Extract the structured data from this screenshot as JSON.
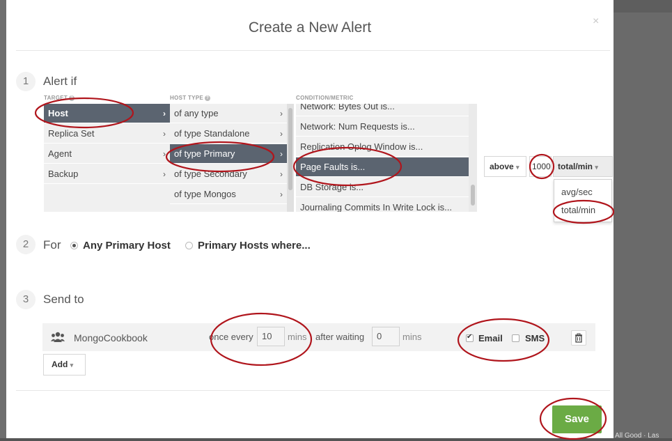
{
  "modal": {
    "title": "Create a New Alert",
    "close_glyph": "×"
  },
  "step1": {
    "number": "1",
    "label": "Alert if",
    "target_header": "TARGET",
    "host_type_header": "HOST TYPE",
    "condition_header": "CONDITION/METRIC",
    "targets": [
      "Host",
      "Replica Set",
      "Agent",
      "Backup"
    ],
    "host_types": [
      "of any type",
      "of type Standalone",
      "of type Primary",
      "of type Secondary",
      "of type Mongos"
    ],
    "conditions": [
      "Network: Bytes Out is...",
      "Network: Num Requests is...",
      "Replication Oplog Window is...",
      "Page Faults is...",
      "DB Storage is...",
      "Journaling Commits In Write Lock is..."
    ],
    "comparator": "above",
    "threshold_value": "1000",
    "unit_selected": "total/min",
    "unit_options": [
      "avg/sec",
      "total/min"
    ]
  },
  "step2": {
    "number": "2",
    "label": "For",
    "option_any": "Any Primary Host",
    "option_where": "Primary Hosts where..."
  },
  "step3": {
    "number": "3",
    "label": "Send to",
    "group_name": "MongoCookbook",
    "once_every_label": "once every",
    "once_every_value": "10",
    "mins_label_1": "mins",
    "after_waiting_label": "after waiting",
    "after_waiting_value": "0",
    "mins_label_2": "mins",
    "email_label": "Email",
    "sms_label": "SMS",
    "add_label": "Add"
  },
  "footer": {
    "save_label": "Save",
    "background_text": "All Good · Las"
  },
  "colors": {
    "selected_row": "#5b6470",
    "save_green": "#6bab45",
    "annotation_red": "#b0151c"
  },
  "icons": [
    "close-icon",
    "help-icon",
    "chevron-right-icon",
    "chevron-down-icon",
    "group-icon",
    "trash-icon"
  ]
}
